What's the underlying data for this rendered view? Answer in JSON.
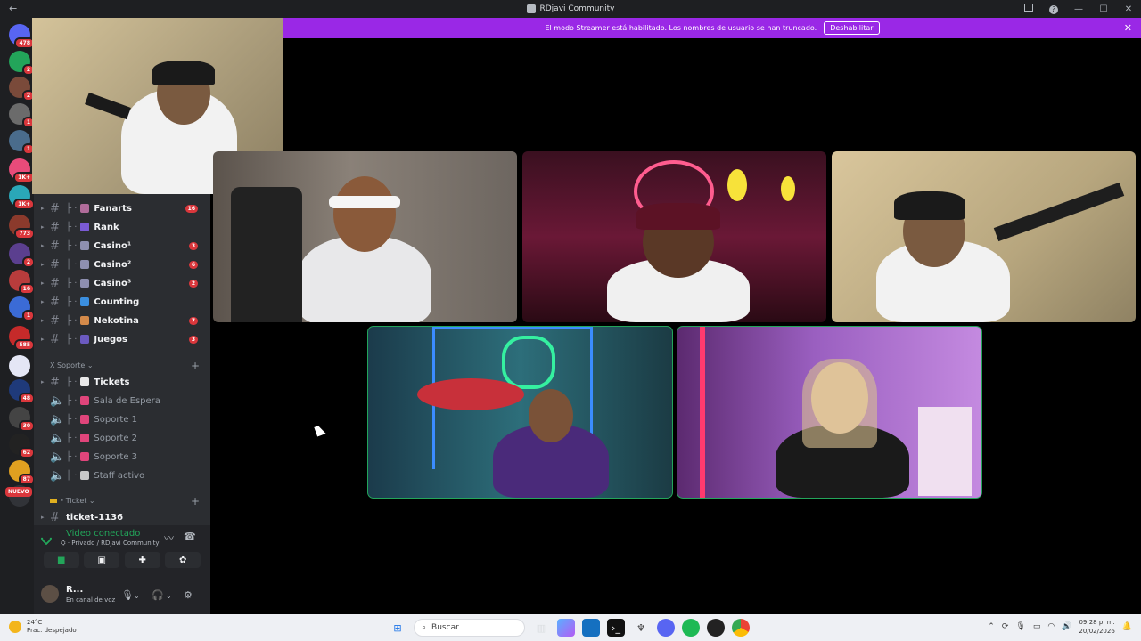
{
  "window": {
    "title": "RDjavi Community"
  },
  "banner": {
    "text": "El modo Streamer está habilitado. Los nombres de usuario se han truncado.",
    "button": "Deshabilitar"
  },
  "guilds": [
    {
      "badge": "478",
      "color": "#5865f2"
    },
    {
      "badge": "2",
      "color": "#23a55a"
    },
    {
      "badge": "2",
      "color": "#7a4a3a"
    },
    {
      "badge": "1",
      "color": "#6b6b6b"
    },
    {
      "badge": "1",
      "color": "#4a6c8c"
    },
    {
      "badge": "1K+",
      "color": "#e94b7a"
    },
    {
      "badge": "1K+",
      "color": "#2aa7b8"
    },
    {
      "badge": "773",
      "color": "#8b3a2c"
    },
    {
      "badge": "2",
      "color": "#5b3f8f"
    },
    {
      "badge": "16",
      "color": "#b83c3c"
    },
    {
      "badge": "1",
      "color": "#3b6bd6"
    },
    {
      "badge": "585",
      "color": "#c52a2a"
    },
    {
      "badge": "",
      "color": "#e4e6f5"
    },
    {
      "badge": "48",
      "color": "#1f3a7a"
    },
    {
      "badge": "30",
      "color": "#444"
    },
    {
      "badge": "62",
      "color": "#222"
    },
    {
      "badge": "87",
      "color": "#e0a020"
    },
    {
      "badge": "",
      "color": "#313338"
    }
  ],
  "nuevo_label": "NUEVO",
  "channels": [
    {
      "name": "Fanarts",
      "count": "16",
      "emoji_color": "#b06c9a",
      "dim": false
    },
    {
      "name": "Rank",
      "count": "",
      "emoji_color": "#7b5bd6",
      "dim": false
    },
    {
      "name": "Casino¹",
      "count": "3",
      "emoji_color": "#8e8fb0",
      "dim": false
    },
    {
      "name": "Casino²",
      "count": "6",
      "emoji_color": "#8e8fb0",
      "dim": false
    },
    {
      "name": "Casino³",
      "count": "2",
      "emoji_color": "#8e8fb0",
      "dim": false
    },
    {
      "name": "Counting",
      "count": "",
      "emoji_color": "#3b8fe0",
      "dim": false
    },
    {
      "name": "Nekotina",
      "count": "7",
      "emoji_color": "#d48a4a",
      "dim": false
    },
    {
      "name": "Juegos",
      "count": "3",
      "emoji_color": "#6b5ac0",
      "dim": false
    }
  ],
  "category_soporte": "X Soporte",
  "soporte_channels": [
    {
      "name": "Tickets",
      "dim": false,
      "voice": false,
      "emoji_color": "#e8e8e8"
    },
    {
      "name": "Sala de Espera",
      "dim": true,
      "voice": true,
      "emoji_color": "#e0457b"
    },
    {
      "name": "Soporte 1",
      "dim": true,
      "voice": true,
      "emoji_color": "#e0457b"
    },
    {
      "name": "Soporte 2",
      "dim": true,
      "voice": true,
      "emoji_color": "#e0457b"
    },
    {
      "name": "Soporte 3",
      "dim": true,
      "voice": true,
      "emoji_color": "#e0457b"
    },
    {
      "name": "Staff activo",
      "dim": true,
      "voice": true,
      "emoji_color": "#c8c8c8"
    }
  ],
  "category_ticket": "Ticket",
  "ticket_channel": "ticket-1136",
  "voice": {
    "status": "Video conectado",
    "sub": "Privado / RDjavi Community"
  },
  "user": {
    "name": "R...",
    "status": "En canal de voz"
  },
  "taskbar": {
    "weather_temp": "24°C",
    "weather_desc": "Prac. despejado",
    "search_placeholder": "Buscar",
    "time": "09:28 p. m.",
    "date": "20/02/2026"
  }
}
